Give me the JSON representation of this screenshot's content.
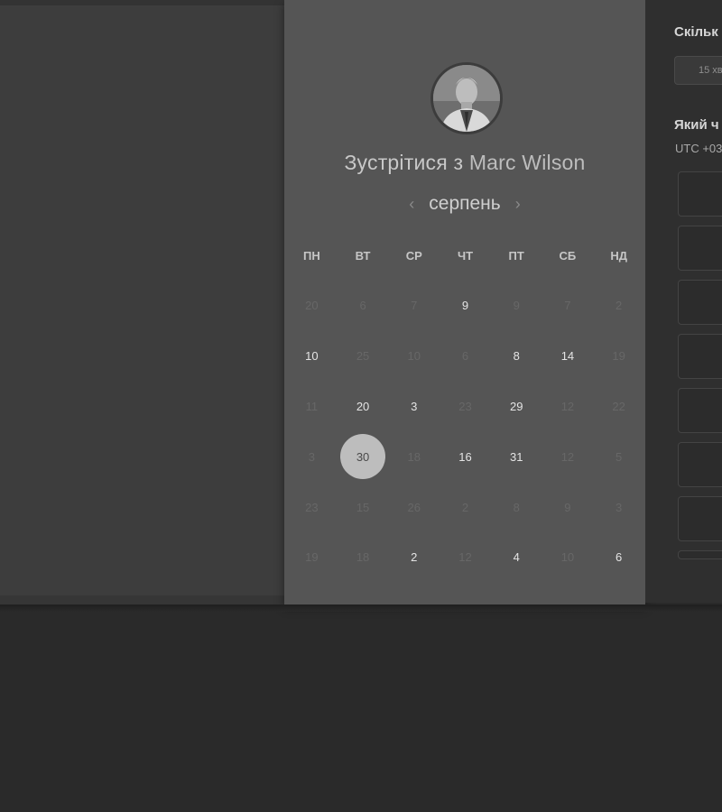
{
  "meeting": {
    "title_prefix": "Зустрітися з",
    "host_name": "Marc Wilson"
  },
  "calendar": {
    "month": "серпень",
    "prev_icon": "‹",
    "next_icon": "›",
    "weekdays": [
      "ПН",
      "ВТ",
      "СР",
      "ЧТ",
      "ПТ",
      "СБ",
      "НД"
    ],
    "rows": [
      [
        {
          "d": "20",
          "a": false
        },
        {
          "d": "6",
          "a": false
        },
        {
          "d": "7",
          "a": false
        },
        {
          "d": "9",
          "a": true
        },
        {
          "d": "9",
          "a": false
        },
        {
          "d": "7",
          "a": false
        },
        {
          "d": "2",
          "a": false
        }
      ],
      [
        {
          "d": "10",
          "a": true
        },
        {
          "d": "25",
          "a": false
        },
        {
          "d": "10",
          "a": false
        },
        {
          "d": "6",
          "a": false
        },
        {
          "d": "8",
          "a": true
        },
        {
          "d": "14",
          "a": true
        },
        {
          "d": "19",
          "a": false
        }
      ],
      [
        {
          "d": "11",
          "a": false
        },
        {
          "d": "20",
          "a": true
        },
        {
          "d": "3",
          "a": true
        },
        {
          "d": "23",
          "a": false
        },
        {
          "d": "29",
          "a": true
        },
        {
          "d": "12",
          "a": false
        },
        {
          "d": "22",
          "a": false
        }
      ],
      [
        {
          "d": "3",
          "a": false
        },
        {
          "d": "30",
          "a": true,
          "selected": true
        },
        {
          "d": "18",
          "a": false
        },
        {
          "d": "16",
          "a": true
        },
        {
          "d": "31",
          "a": true
        },
        {
          "d": "12",
          "a": false
        },
        {
          "d": "5",
          "a": false
        }
      ],
      [
        {
          "d": "23",
          "a": false
        },
        {
          "d": "15",
          "a": false
        },
        {
          "d": "26",
          "a": false
        },
        {
          "d": "2",
          "a": false
        },
        {
          "d": "8",
          "a": false
        },
        {
          "d": "9",
          "a": false
        },
        {
          "d": "3",
          "a": false
        }
      ],
      [
        {
          "d": "19",
          "a": false
        },
        {
          "d": "18",
          "a": false
        },
        {
          "d": "2",
          "a": true
        },
        {
          "d": "12",
          "a": false
        },
        {
          "d": "4",
          "a": true
        },
        {
          "d": "10",
          "a": false
        },
        {
          "d": "6",
          "a": true
        }
      ]
    ]
  },
  "sidebar": {
    "duration_label": "Скільк",
    "duration_value": "15 хв",
    "time_label": "Який ч",
    "timezone": "UTC +03"
  },
  "colors": {
    "card_bg": "#555555",
    "selected_day_bg": "#bdbdbd"
  }
}
